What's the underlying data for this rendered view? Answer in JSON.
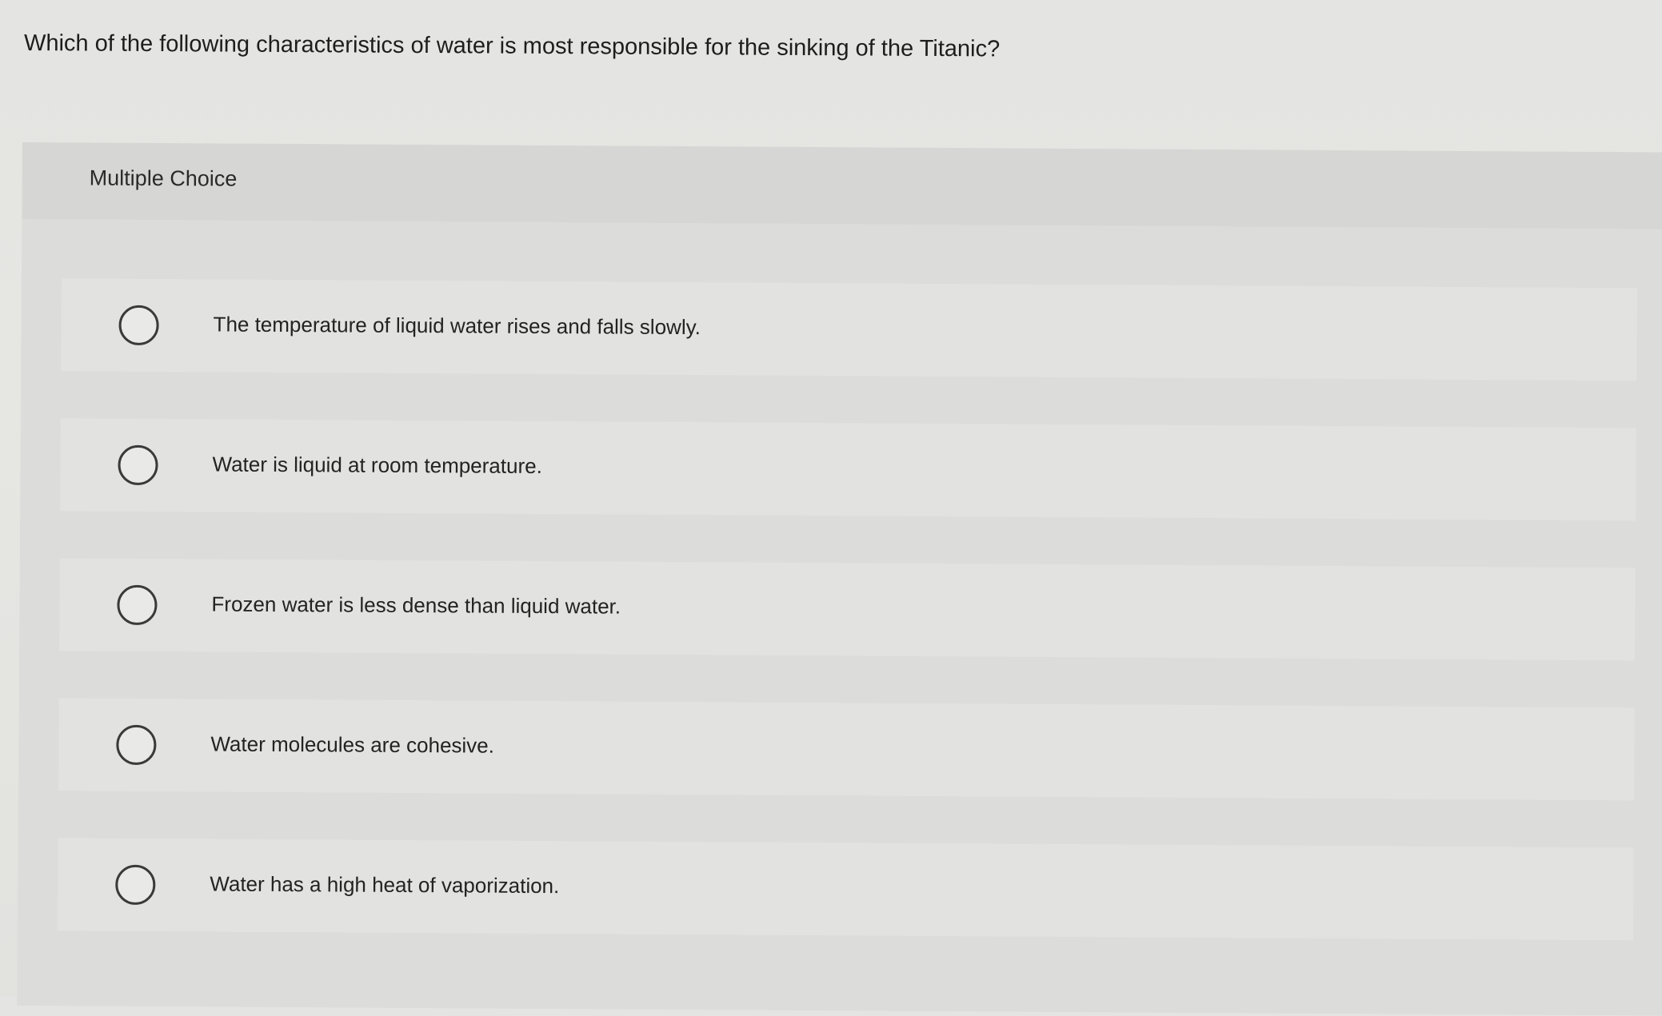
{
  "question": {
    "text": "Which of the following characteristics of water is most responsible for the sinking of the Titanic?"
  },
  "multiple_choice": {
    "label": "Multiple Choice",
    "options": [
      {
        "text": "The temperature of liquid water rises and falls slowly.",
        "selected": false
      },
      {
        "text": "Water is liquid at room temperature.",
        "selected": false
      },
      {
        "text": "Frozen water is less dense than liquid water.",
        "selected": false
      },
      {
        "text": "Water molecules are cohesive.",
        "selected": false
      },
      {
        "text": "Water has a high heat of vaporization.",
        "selected": false
      }
    ]
  },
  "colors": {
    "background": "#e4e4e2",
    "panel": "#dcdcda",
    "option_row": "#e2e2e0",
    "radio_border": "#3a3a3a",
    "text": "#222222"
  },
  "icons": {
    "radio": "radio-unchecked-icon"
  }
}
